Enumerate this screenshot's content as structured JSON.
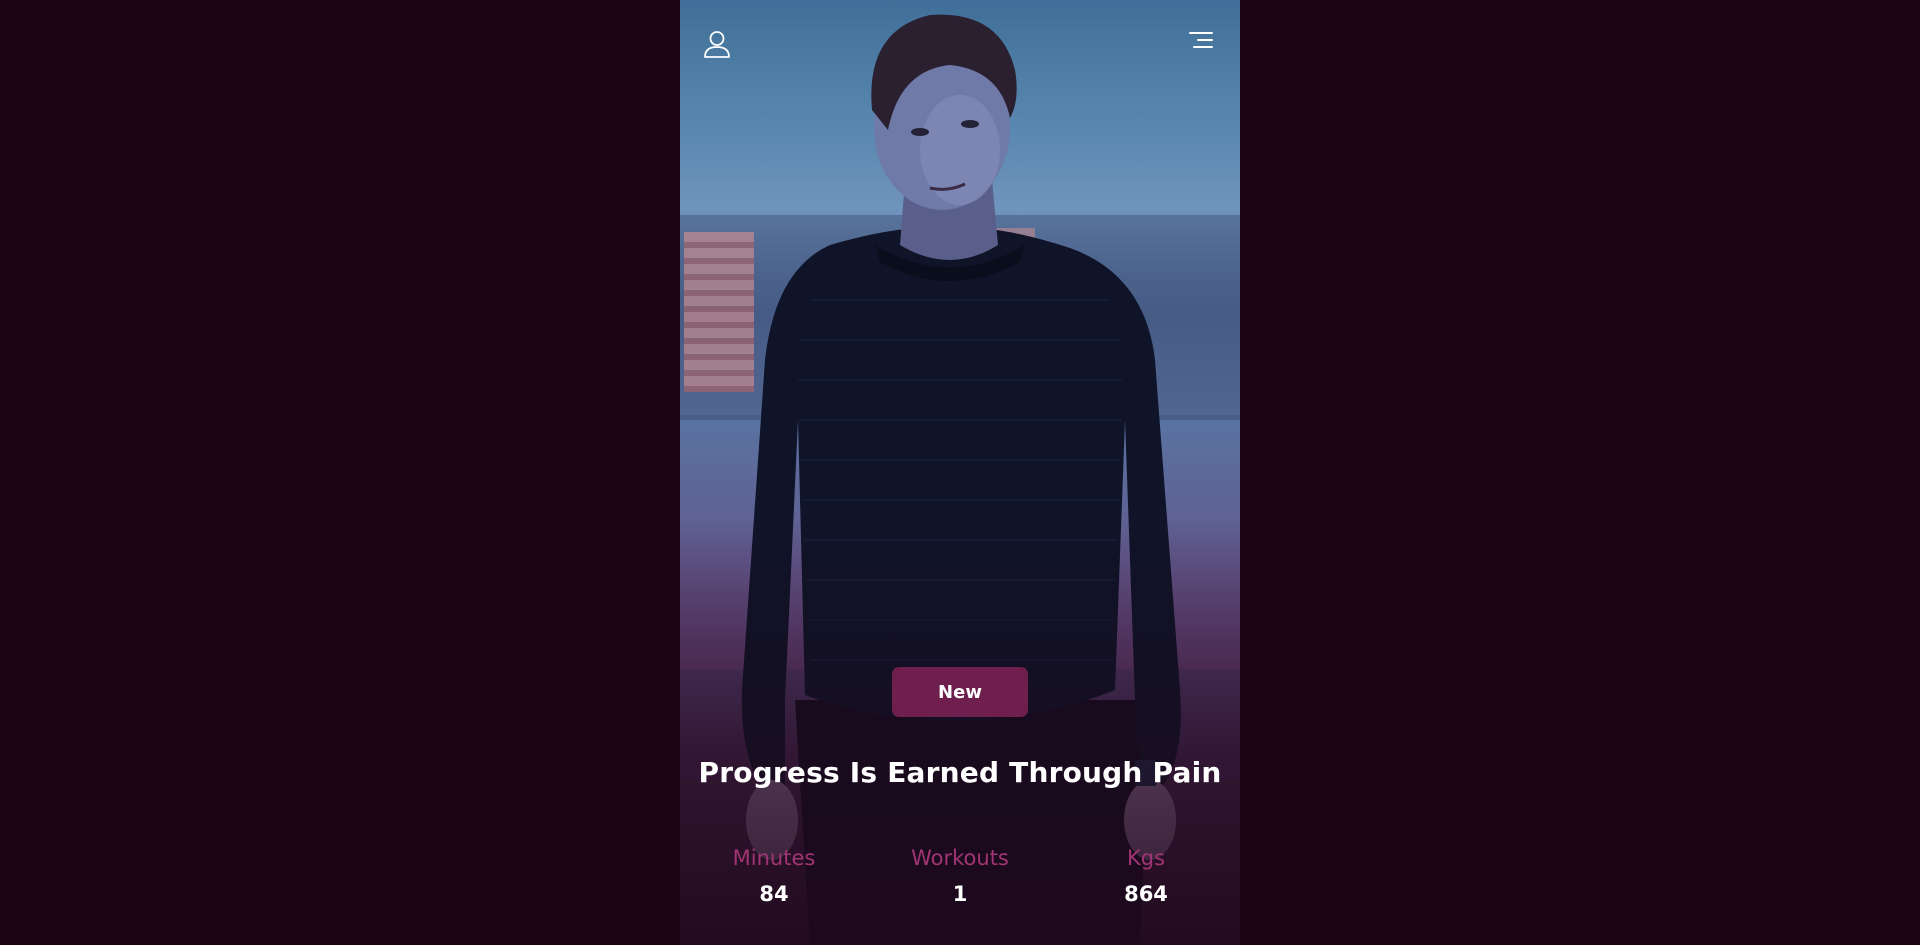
{
  "header": {
    "profile_icon": "user-icon",
    "menu_icon": "hamburger-menu-icon"
  },
  "hero": {
    "badge": "New",
    "title": "Progress Is Earned Through Pain"
  },
  "stats": [
    {
      "label": "Minutes",
      "value": "84"
    },
    {
      "label": "Workouts",
      "value": "1"
    },
    {
      "label": "Kgs",
      "value": "864"
    }
  ],
  "colors": {
    "page_background": "#1a0413",
    "badge_background": "#6e1f4d",
    "stat_label": "#a13574",
    "text_primary": "#ffffff"
  }
}
